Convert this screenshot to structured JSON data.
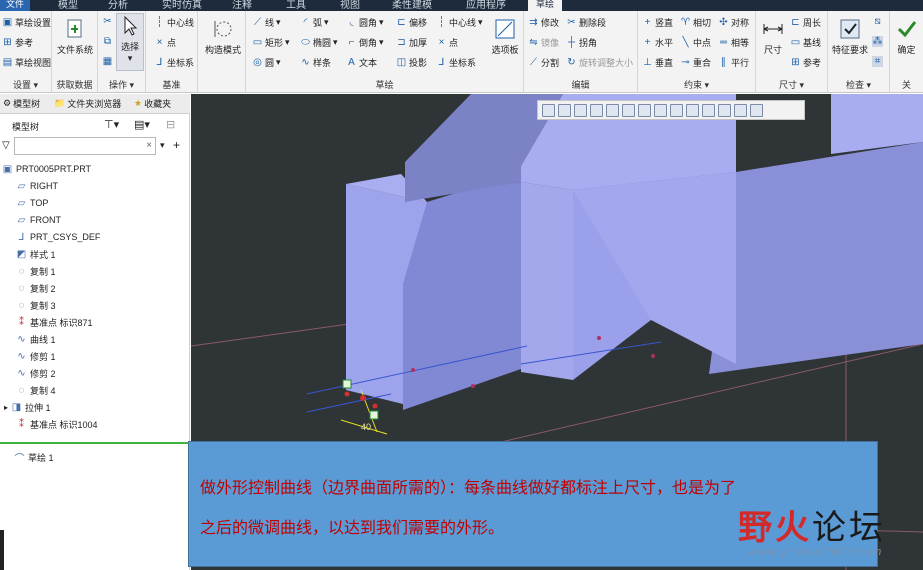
{
  "tabs": [
    "文件",
    "模型",
    "分析",
    "实时仿真",
    "注释",
    "工具",
    "视图",
    "柔性建模",
    "应用程序",
    "草绘"
  ],
  "ribbon": {
    "setup": {
      "label": "设置",
      "items": [
        "草绘设置",
        "参考",
        "草绘视图"
      ]
    },
    "data": {
      "label": "获取数据",
      "filesys": "文件系统"
    },
    "ops": {
      "label": "操作",
      "select": "选择"
    },
    "datum": {
      "label": "基准",
      "items": [
        "中心线",
        "点",
        "坐标系"
      ]
    },
    "construct": {
      "label": "构造模式"
    },
    "sketch": {
      "label": "草绘",
      "col1": [
        "线",
        "矩形",
        "圆"
      ],
      "col2": [
        "弧",
        "椭圆",
        "样条"
      ],
      "col3": [
        "圆角",
        "倒角",
        "文本"
      ],
      "col4": [
        "偏移",
        "加厚",
        "投影"
      ],
      "col5": [
        "中心线",
        "点",
        "坐标系"
      ],
      "palette": "选项板"
    },
    "edit": {
      "label": "编辑",
      "items": [
        "修改",
        "删除段",
        "镜像",
        "拐角",
        "分割",
        "旋转调整大小"
      ]
    },
    "constrain": {
      "label": "约束",
      "items": [
        "竖直",
        "相切",
        "对称",
        "水平",
        "中点",
        "相等",
        "垂直",
        "重合",
        "平行"
      ]
    },
    "dimension": {
      "label": "尺寸",
      "main": "尺寸",
      "items": [
        "周长",
        "基线",
        "参考"
      ]
    },
    "inspect": {
      "label": "检查",
      "main": "特征要求"
    },
    "close": {
      "label": "关",
      "ok": "确定"
    }
  },
  "panel": {
    "tab_tree": "模型树",
    "tab_browser": "文件夹浏览器",
    "tab_fav": "收藏夹",
    "tree_title": "模型树",
    "root": "PRT0005PRT.PRT",
    "items": [
      "RIGHT",
      "TOP",
      "FRONT",
      "PRT_CSYS_DEF",
      "样式 1",
      "复制 1",
      "复制 2",
      "复制 3",
      "基准点 标识871",
      "曲线 1",
      "修剪 1",
      "修剪 2",
      "复制 4",
      "拉伸 1",
      "基准点 标识1004"
    ],
    "bottom_item": "草绘 1"
  },
  "viewport": {
    "dim_label": "40"
  },
  "annotation": {
    "line1": "做外形控制曲线（边界曲面所需的）：每条曲线做好都标注上尺寸，也是为了",
    "line2": "之后的微调曲线，以达到我们需要的外形。"
  },
  "watermark": {
    "cn_a": "野火",
    "cn_b": "论坛",
    "url": "www.proewildfire.cn"
  }
}
